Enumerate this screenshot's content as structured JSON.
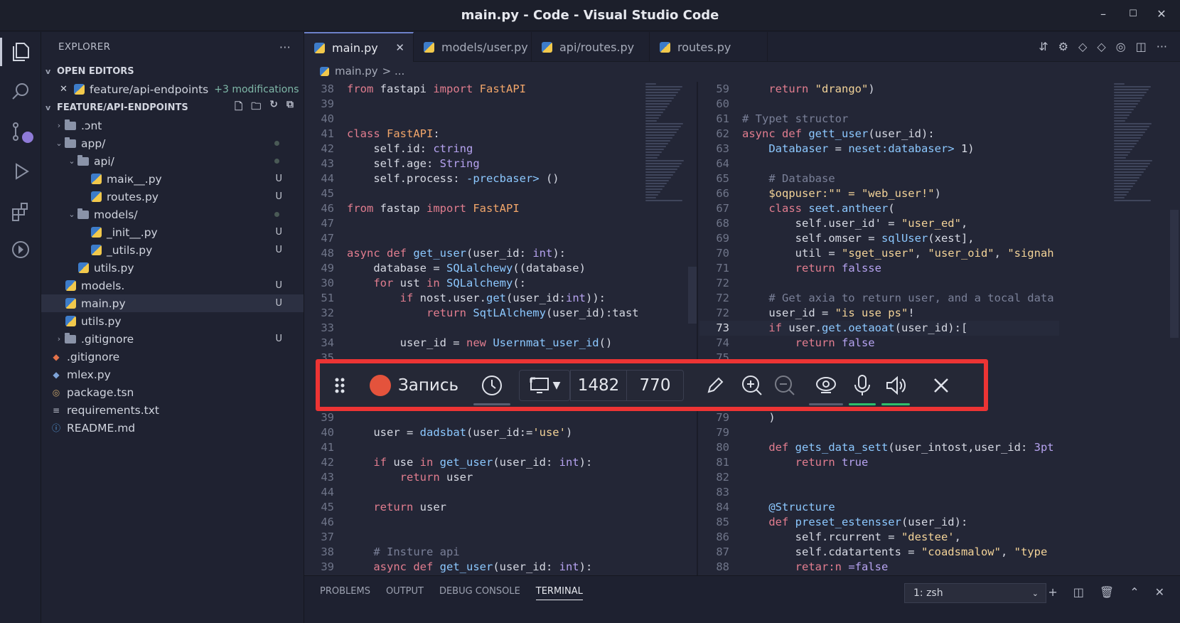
{
  "window": {
    "title": "main.py - Code - Visual Studio Code"
  },
  "explorer": {
    "title": "EXPLORER",
    "open_editors_label": "OPEN EDITORS",
    "open_editor": {
      "name": "feature/api-endpoints",
      "mods": "+3 modifications"
    },
    "folder_label": "FEATURE/API-ENDPOINTS",
    "tree": [
      {
        "name": ".‍ɔnt",
        "indent": 0,
        "kind": "folder",
        "caret": ">",
        "status": ""
      },
      {
        "name": "app/",
        "indent": 0,
        "kind": "folder",
        "caret": "v",
        "status": "dot"
      },
      {
        "name": "api/",
        "indent": 1,
        "kind": "folder",
        "caret": "v",
        "status": "dot"
      },
      {
        "name": "maiк__.py",
        "indent": 2,
        "kind": "py",
        "caret": "",
        "status": "U"
      },
      {
        "name": "routes.py",
        "indent": 2,
        "kind": "py",
        "caret": "",
        "status": "U"
      },
      {
        "name": "models/",
        "indent": 1,
        "kind": "folder",
        "caret": "v",
        "status": "dot"
      },
      {
        "name": "_init__.py",
        "indent": 2,
        "kind": "py",
        "caret": "",
        "status": "U"
      },
      {
        "name": "_utils.py",
        "indent": 2,
        "kind": "py",
        "caret": "",
        "status": "U"
      },
      {
        "name": "utils.py",
        "indent": 1,
        "kind": "py",
        "caret": "",
        "status": ""
      },
      {
        "name": "models.",
        "indent": 0,
        "kind": "py",
        "caret": "",
        "status": "U"
      },
      {
        "name": "main.py",
        "indent": 0,
        "kind": "py",
        "caret": "",
        "status": "U",
        "selected": true
      },
      {
        "name": "utils.py",
        "indent": 0,
        "kind": "py",
        "caret": "",
        "status": ""
      },
      {
        "name": ".gitignore",
        "indent": 0,
        "kind": "folder",
        "caret": ">",
        "status": "U"
      },
      {
        "name": ".gitignore",
        "indent": -1,
        "kind": "git",
        "caret": "",
        "status": ""
      },
      {
        "name": "mlex.py",
        "indent": -1,
        "kind": "diamond",
        "caret": "",
        "status": ""
      },
      {
        "name": "package.tsn",
        "indent": -1,
        "kind": "pkg",
        "caret": "",
        "status": ""
      },
      {
        "name": "requirements.txt",
        "indent": -1,
        "kind": "txt",
        "caret": "",
        "status": ""
      },
      {
        "name": "README.md",
        "indent": -1,
        "kind": "info",
        "caret": "",
        "status": ""
      }
    ]
  },
  "tabs": [
    {
      "label": "main.py",
      "active": true
    },
    {
      "label": "models/user.py",
      "active": false
    },
    {
      "label": "api/routes.py",
      "active": false
    },
    {
      "label": "routes.py",
      "active": false
    }
  ],
  "breadcrumb": {
    "file": "main.py",
    "rest": "> ..."
  },
  "left_code": [
    {
      "n": "38",
      "t": [
        [
          "kw",
          "from "
        ],
        [
          "",
          "fastapi "
        ],
        [
          "kw",
          "import "
        ],
        [
          "cl",
          "FastAPI"
        ]
      ]
    },
    {
      "n": "39",
      "t": []
    },
    {
      "n": "40",
      "t": []
    },
    {
      "n": "41",
      "t": [
        [
          "kw",
          "class "
        ],
        [
          "cl",
          "FastAPI"
        ],
        [
          "",
          ":"
        ]
      ]
    },
    {
      "n": "42",
      "t": [
        [
          "",
          "    self.id: "
        ],
        [
          "tp",
          "ctring"
        ]
      ]
    },
    {
      "n": "43",
      "t": [
        [
          "",
          "    self.age: "
        ],
        [
          "tp",
          "String"
        ]
      ]
    },
    {
      "n": "44",
      "t": [
        [
          "",
          "    self.process: "
        ],
        [
          "fn",
          "-precbaser> "
        ],
        [
          "",
          "()"
        ]
      ]
    },
    {
      "n": "45",
      "t": []
    },
    {
      "n": "46",
      "t": [
        [
          "kw",
          "from "
        ],
        [
          "",
          "fastap "
        ],
        [
          "kw",
          "import "
        ],
        [
          "cl",
          "FastAPI"
        ]
      ]
    },
    {
      "n": "47",
      "t": []
    },
    {
      "n": "47",
      "t": []
    },
    {
      "n": "48",
      "t": [
        [
          "kw",
          "async def "
        ],
        [
          "fn",
          "get_user"
        ],
        [
          "",
          "(user_id: "
        ],
        [
          "tp",
          "int"
        ],
        [
          "",
          "):"
        ]
      ]
    },
    {
      "n": "49",
      "t": [
        [
          "",
          "    database = "
        ],
        [
          "fn",
          "SQLalchewy"
        ],
        [
          "",
          "((database)"
        ]
      ]
    },
    {
      "n": "30",
      "t": [
        [
          "kw",
          "    for "
        ],
        [
          "",
          "ust "
        ],
        [
          "kw",
          "in "
        ],
        [
          "fn",
          "SQLalchemy"
        ],
        [
          "",
          "(:"
        ]
      ]
    },
    {
      "n": "51",
      "t": [
        [
          "kw",
          "        if "
        ],
        [
          "",
          "nost.user."
        ],
        [
          "fn",
          "get"
        ],
        [
          "",
          "(user_id:"
        ],
        [
          "tp",
          "int"
        ],
        [
          "",
          ")):"
        ]
      ]
    },
    {
      "n": "32",
      "t": [
        [
          "kw",
          "            return "
        ],
        [
          "fn",
          "SqtLAlchemy"
        ],
        [
          "",
          "(user_id):tast"
        ]
      ]
    },
    {
      "n": "33",
      "t": []
    },
    {
      "n": "34",
      "t": [
        [
          "",
          "        user_id = "
        ],
        [
          "kw",
          "new "
        ],
        [
          "fn",
          "Usernmat_user_id"
        ],
        [
          "",
          "()"
        ]
      ]
    },
    {
      "n": "35",
      "t": []
    },
    {
      "n": "36",
      "t": []
    },
    {
      "n": "37",
      "t": []
    },
    {
      "n": "38",
      "t": []
    },
    {
      "n": "39",
      "t": []
    },
    {
      "n": "40",
      "t": [
        [
          "",
          "    user = "
        ],
        [
          "fn",
          "dadsbat"
        ],
        [
          "",
          "(user_id:="
        ],
        [
          "st",
          "'use'"
        ],
        [
          "",
          ")"
        ]
      ]
    },
    {
      "n": "41",
      "t": []
    },
    {
      "n": "42",
      "t": [
        [
          "kw",
          "    if "
        ],
        [
          "",
          "use "
        ],
        [
          "kw",
          "in "
        ],
        [
          "fn",
          "get_user"
        ],
        [
          "",
          "(user_id: "
        ],
        [
          "tp",
          "int"
        ],
        [
          "",
          "):"
        ]
      ]
    },
    {
      "n": "43",
      "t": [
        [
          "kw",
          "        return "
        ],
        [
          "",
          "user"
        ]
      ]
    },
    {
      "n": "44",
      "t": []
    },
    {
      "n": "45",
      "t": [
        [
          "kw",
          "    return "
        ],
        [
          "",
          "user"
        ]
      ]
    },
    {
      "n": "46",
      "t": []
    },
    {
      "n": "37",
      "t": []
    },
    {
      "n": "38",
      "t": [
        [
          "cm",
          "    # Insture api"
        ]
      ]
    },
    {
      "n": "39",
      "t": [
        [
          "kw",
          "    async def "
        ],
        [
          "fn",
          "get_user"
        ],
        [
          "",
          "(user_id: "
        ],
        [
          "tp",
          "int"
        ],
        [
          "",
          "):"
        ]
      ]
    }
  ],
  "right_code": [
    {
      "n": "59",
      "t": [
        [
          "kw",
          "    return "
        ],
        [
          "st",
          "\"drango\""
        ],
        [
          "",
          ")"
        ]
      ]
    },
    {
      "n": "60",
      "t": []
    },
    {
      "n": "61",
      "t": [
        [
          "cm",
          "# Typet structor"
        ]
      ]
    },
    {
      "n": "62",
      "t": [
        [
          "kw",
          "async def "
        ],
        [
          "fn",
          "gett_user"
        ],
        [
          "",
          "(user_id):"
        ]
      ]
    },
    {
      "n": "63",
      "t": [
        [
          "fn",
          "    Databaser "
        ],
        [
          "",
          "= "
        ],
        [
          "fn",
          "neset:databaser> "
        ],
        [
          "",
          "1)"
        ]
      ]
    },
    {
      "n": "64",
      "t": []
    },
    {
      "n": "65",
      "t": [
        [
          "cm",
          "    # Database"
        ]
      ]
    },
    {
      "n": "66",
      "t": [
        [
          "st",
          "    $oqpuser:\"\" = \"web_user!\""
        ],
        [
          "",
          ")"
        ]
      ]
    },
    {
      "n": "67",
      "t": [
        [
          "kw",
          "    class "
        ],
        [
          "fn",
          "seet.antheer"
        ],
        [
          "",
          "("
        ]
      ]
    },
    {
      "n": "68",
      "t": [
        [
          "",
          "        self.user_id' = "
        ],
        [
          "st",
          "\"user_ed\""
        ],
        [
          "",
          ","
        ]
      ]
    },
    {
      "n": "69",
      "t": [
        [
          "",
          "        self.omser = "
        ],
        [
          "fn",
          "sqlUser"
        ],
        [
          "",
          "(xest],"
        ]
      ]
    },
    {
      "n": "70",
      "t": [
        [
          "",
          "        util = "
        ],
        [
          "st",
          "\"sget_user\""
        ],
        [
          "",
          ", "
        ],
        [
          "st",
          "\"user_oid\""
        ],
        [
          "",
          ", "
        ],
        [
          "st",
          "\"signah"
        ]
      ]
    },
    {
      "n": "71",
      "t": [
        [
          "kw",
          "        return "
        ],
        [
          "tp",
          "falsse"
        ]
      ]
    },
    {
      "n": "72",
      "t": []
    },
    {
      "n": "72",
      "t": [
        [
          "cm",
          "    # Get axia to return user, and a tocal data"
        ]
      ]
    },
    {
      "n": "72",
      "t": [
        [
          "",
          "    user_id = "
        ],
        [
          "st",
          "\"is use ps\""
        ],
        [
          "",
          "!"
        ]
      ]
    },
    {
      "n": "73",
      "t": [
        [
          "kw",
          "    if "
        ],
        [
          "",
          "user."
        ],
        [
          "fn",
          "get.oetaoat"
        ],
        [
          "",
          "(user_id):["
        ]
      ],
      "cur": true
    },
    {
      "n": "74",
      "t": [
        [
          "kw",
          "        return "
        ],
        [
          "tp",
          "false"
        ]
      ]
    },
    {
      "n": "75",
      "t": []
    },
    {
      "n": "76",
      "t": []
    },
    {
      "n": "77",
      "t": []
    },
    {
      "n": "78",
      "t": []
    },
    {
      "n": "79",
      "t": [
        [
          "",
          "    )"
        ]
      ]
    },
    {
      "n": "79",
      "t": []
    },
    {
      "n": "80",
      "t": [
        [
          "kw",
          "    def "
        ],
        [
          "fn",
          "gets_data_sett"
        ],
        [
          "",
          "(user_intost,user_id: "
        ],
        [
          "tp",
          "3pt"
        ]
      ]
    },
    {
      "n": "81",
      "t": [
        [
          "kw",
          "        return "
        ],
        [
          "tp",
          "true"
        ]
      ]
    },
    {
      "n": "82",
      "t": []
    },
    {
      "n": "83",
      "t": []
    },
    {
      "n": "84",
      "t": [
        [
          "fn",
          "    @Structure"
        ]
      ]
    },
    {
      "n": "85",
      "t": [
        [
          "kw",
          "    def "
        ],
        [
          "fn",
          "preset_estensser"
        ],
        [
          "",
          "(user_id):"
        ]
      ]
    },
    {
      "n": "86",
      "t": [
        [
          "",
          "        self.rcurrent = "
        ],
        [
          "st",
          "\"destee'"
        ],
        [
          "",
          ","
        ]
      ]
    },
    {
      "n": "87",
      "t": [
        [
          "",
          "        self.cdatartents = "
        ],
        [
          "st",
          "\"coadsmalow\""
        ],
        [
          "",
          ", "
        ],
        [
          "st",
          "\"type"
        ]
      ]
    },
    {
      "n": "88",
      "t": [
        [
          "kw",
          "        retar:n "
        ],
        [
          "tp",
          "=false"
        ]
      ]
    }
  ],
  "panel": {
    "tabs": [
      "PROBLEMS",
      "OUTPUT",
      "DEBUG CONSOLE",
      "TERMINAL"
    ],
    "active_tab": "TERMINAL",
    "terminal_select": "1: zsh"
  },
  "recorder": {
    "record_label": "Запись",
    "width_value": "1482",
    "height_value": "770",
    "accent": "#ed3434",
    "green_indicator": "#2fbf6b"
  }
}
